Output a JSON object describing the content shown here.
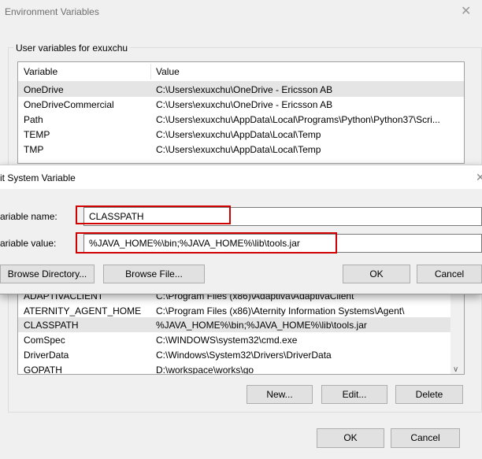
{
  "main_window": {
    "title": "Environment Variables",
    "user_group_label": "User variables for exuxchu",
    "columns": {
      "variable": "Variable",
      "value": "Value"
    },
    "user_vars": [
      {
        "name": "OneDrive",
        "value": "C:\\Users\\exuxchu\\OneDrive - Ericsson AB"
      },
      {
        "name": "OneDriveCommercial",
        "value": "C:\\Users\\exuxchu\\OneDrive - Ericsson AB"
      },
      {
        "name": "Path",
        "value": "C:\\Users\\exuxchu\\AppData\\Local\\Programs\\Python\\Python37\\Scri..."
      },
      {
        "name": "TEMP",
        "value": "C:\\Users\\exuxchu\\AppData\\Local\\Temp"
      },
      {
        "name": "TMP",
        "value": "C:\\Users\\exuxchu\\AppData\\Local\\Temp"
      }
    ],
    "system_vars": [
      {
        "name": "ADAPTIVACLIENT",
        "value": "C:\\Program Files (x86)\\Adaptiva\\AdaptivaClient"
      },
      {
        "name": "ATERNITY_AGENT_HOME",
        "value": "C:\\Program Files (x86)\\Aternity Information Systems\\Agent\\"
      },
      {
        "name": "CLASSPATH",
        "value": "%JAVA_HOME%\\bin;%JAVA_HOME%\\lib\\tools.jar"
      },
      {
        "name": "ComSpec",
        "value": "C:\\WINDOWS\\system32\\cmd.exe"
      },
      {
        "name": "DriverData",
        "value": "C:\\Windows\\System32\\Drivers\\DriverData"
      },
      {
        "name": "GOPATH",
        "value": "D:\\workspace\\works\\go"
      }
    ],
    "system_buttons": {
      "new": "New...",
      "edit": "Edit...",
      "delete": "Delete"
    },
    "ok": "OK",
    "cancel": "Cancel"
  },
  "edit_dialog": {
    "title": "it System Variable",
    "name_label": "ariable name:",
    "value_label": "ariable value:",
    "name_value": "CLASSPATH",
    "value_value": "%JAVA_HOME%\\bin;%JAVA_HOME%\\lib\\tools.jar",
    "browse_directory": "Browse Directory...",
    "browse_file": "Browse File...",
    "ok": "OK",
    "cancel": "Cancel"
  },
  "colors": {
    "highlight": "#d10000",
    "selected_row": "#e5e5e5"
  }
}
